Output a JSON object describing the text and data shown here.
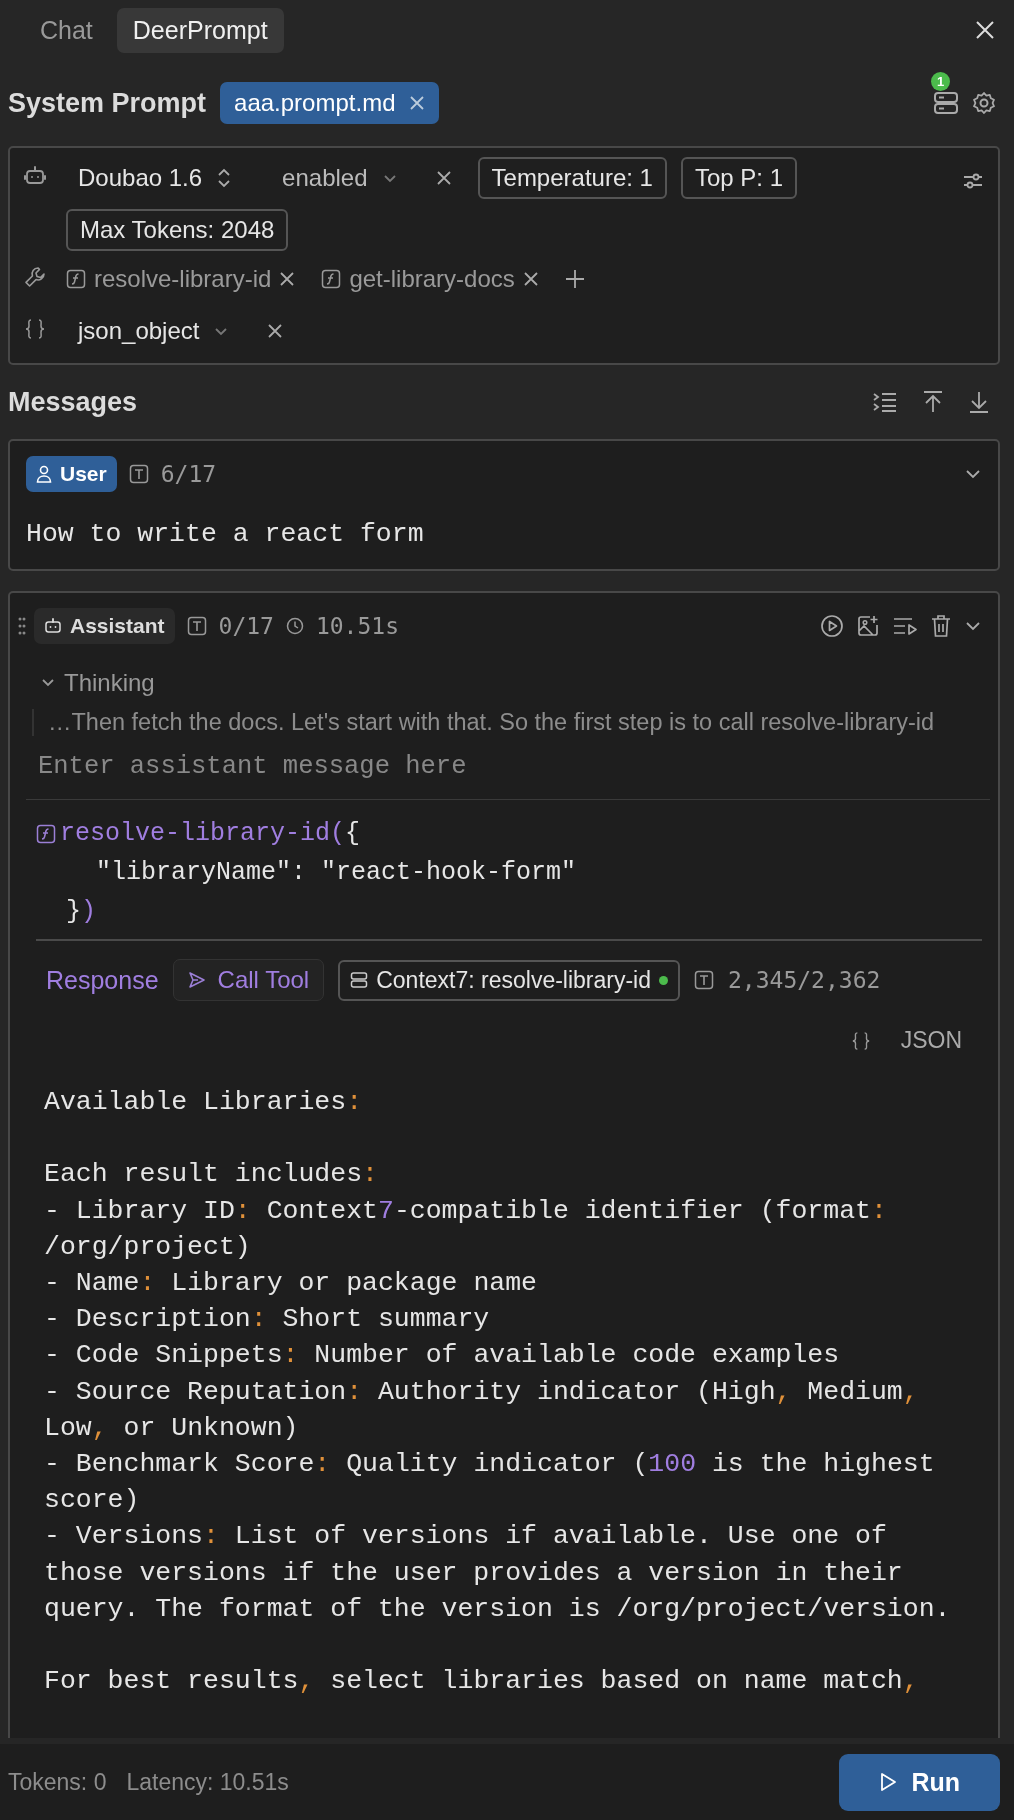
{
  "tabs": [
    {
      "label": "Chat",
      "selected": false
    },
    {
      "label": "DeerPrompt",
      "selected": true
    }
  ],
  "system_prompt": {
    "title": "System Prompt",
    "file": "aaa.prompt.md",
    "server_badge": "1"
  },
  "model": {
    "name": "Doubao 1.6",
    "thinking": "enabled",
    "params": [
      "Temperature: 1",
      "Top P: 1",
      "Max Tokens: 2048"
    ]
  },
  "tools": [
    "resolve-library-id",
    "get-library-docs"
  ],
  "response_format": "json_object",
  "messages_title": "Messages",
  "messages": [
    {
      "kind": "user",
      "role": "User",
      "tokens": "6/17",
      "text": "How to write a react form"
    },
    {
      "kind": "assistant",
      "role": "Assistant",
      "tokens": "0/17",
      "time": "10.51s",
      "thinking_label": "Thinking",
      "thinking_expanded": true,
      "thinking_text": "…Then fetch the docs. Let's start with that. So the first step is to call resolve-library-id",
      "placeholder": "Enter assistant message here",
      "tool_call": {
        "call": "resolve-library-id(",
        "open": "{",
        "arg": "\"libraryName\": \"react-hook-form\"",
        "close_brace": "}",
        "close_paren": ")"
      },
      "response": {
        "label": "Response",
        "call_tool": "Call Tool",
        "server": "Context7: resolve-library-id",
        "server_online": true,
        "tokens": "2,345/2,362",
        "format": "JSON",
        "blocks": [
          [
            "Available Libraries:"
          ],
          [
            "Each result includes:",
            "- Library ID: Context7-compatible identifier (format: /org/project)",
            "- Name: Library or package name",
            "- Description: Short summary",
            "- Code Snippets: Number of available code examples",
            "- Source Reputation: Authority indicator (High, Medium, Low, or Unknown)",
            "- Benchmark Score: Quality indicator (100 is the highest score)",
            "- Versions: List of versions if available. Use one of those versions if the user provides a version in their query. The format of the version is /org/project/version."
          ],
          [
            "For best results, select libraries based on name match,"
          ]
        ]
      }
    }
  ],
  "footer": {
    "tokens": "Tokens: 0",
    "latency": "Latency: 10.51s",
    "run": "Run"
  }
}
